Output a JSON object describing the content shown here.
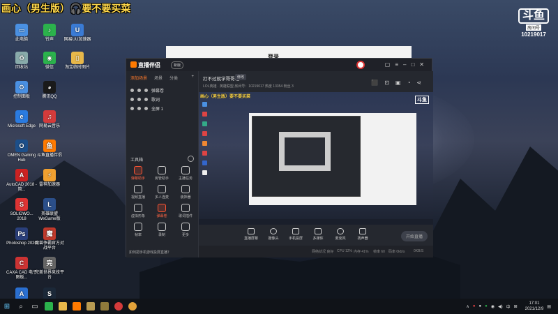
{
  "overlay": {
    "prefix": "画心（男生版）",
    "suffix": "要不要买菜"
  },
  "desktop": {
    "icons": [
      {
        "label": "此电脑"
      },
      {
        "label": "铃声"
      },
      {
        "label": "网易UU加速器"
      },
      {
        "label": "回收站"
      },
      {
        "label": "微信"
      },
      {
        "label": "淘宝临时图片"
      },
      {
        "label": "控制面板"
      },
      {
        "label": "腾讯QQ"
      },
      {
        "label": "Microsoft Edge"
      },
      {
        "label": "网易云音乐"
      },
      {
        "label": "OMEN Gaming Hub"
      },
      {
        "label": "斗鱼直播伴侣"
      },
      {
        "label": "AutoCAD 2018 - 简..."
      },
      {
        "label": "雷神加速器"
      },
      {
        "label": "SOLIDWO... 2018"
      },
      {
        "label": "英雄联盟WeGame版"
      },
      {
        "label": "Photoshop 2020"
      },
      {
        "label": "魔兽争霸官方对战平台"
      },
      {
        "label": "CAXA CAD 电子图板..."
      },
      {
        "label": "完美世界竞技平台"
      },
      {
        "label": "AIWorkbe... - 快捷方式"
      },
      {
        "label": "Steam"
      }
    ]
  },
  "douyu": {
    "mark": "斗鱼",
    "sub": "房间号",
    "room": "10219017"
  },
  "bg_window": {
    "title": "登录"
  },
  "app": {
    "name": "直播伴侣",
    "version_badge": "新版",
    "tabs": [
      "添加场景",
      "场景",
      "分类"
    ],
    "scenes": [
      "弹幕卷",
      "歌词",
      "全屏 1"
    ],
    "tools_label": "工具箱",
    "tools": [
      {
        "label": "弹幕助手",
        "hot": true
      },
      {
        "label": "房管助手",
        "hot": false
      },
      {
        "label": "主播任务",
        "hot": false
      },
      {
        "label": "视频直播",
        "hot": false
      },
      {
        "label": "多人连麦",
        "hot": false
      },
      {
        "label": "装饰器",
        "hot": false
      },
      {
        "label": "虚拟形象",
        "hot": false
      },
      {
        "label": "弹幕卷",
        "hot": true
      },
      {
        "label": "歌词插件",
        "hot": false
      },
      {
        "label": "帧率",
        "hot": false
      },
      {
        "label": "录制",
        "hot": false
      },
      {
        "label": "更多",
        "hot": false
      }
    ],
    "footer_hint": "如何把手机游戏投屏直播？",
    "room_title": "打不过就学哥哥吧",
    "edit_label": "修改",
    "meta": "LOL英雄 · 英雄联盟  房间号：10219017  热度 13354  粉丝 3",
    "preview_overlay_title": "画心（男生版）要不要买菜",
    "preview_logo": "斗鱼",
    "controls": [
      "直播屏幕",
      "摄像头",
      "手机投屏",
      "多媒体",
      "麦克风",
      "扬声器"
    ],
    "start_label": "开始直播",
    "status": [
      "网络状况 良好",
      "CPU 12%",
      "内存 41%",
      "帧率 60",
      "码率 0kb/s",
      "0KB/S"
    ]
  },
  "taskbar": {
    "tray_lang": "中",
    "time": "17:01",
    "date": "2021/12/9"
  }
}
